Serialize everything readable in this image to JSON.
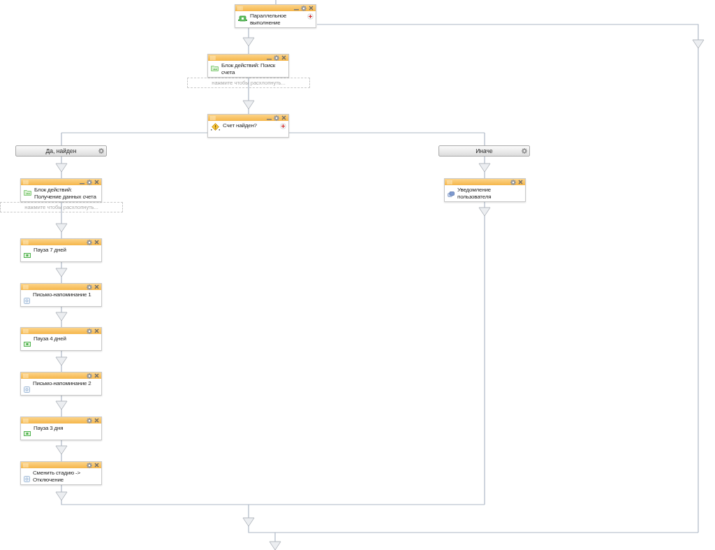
{
  "nodes": [
    {
      "kind": "parallel",
      "title": "Параллельное выполнение",
      "minimizable": true,
      "addable": true
    },
    {
      "kind": "block",
      "title": "Блок действий: Поиск счета",
      "minimizable": true,
      "addable": false,
      "hint": "нажмите чтобы расхлопнуть..."
    },
    {
      "kind": "condition",
      "title": "Счет найден?",
      "minimizable": true,
      "addable": true
    },
    {
      "kind": "block",
      "title": "Блок действий: Получение данных счета",
      "minimizable": true,
      "addable": false,
      "hint": "нажмите чтобы расхлопнуть..."
    },
    {
      "kind": "notify",
      "title": "Уведомление пользователя",
      "minimizable": false,
      "addable": false
    },
    {
      "kind": "delay",
      "title": "Пауза 7 дней",
      "minimizable": false,
      "addable": false
    },
    {
      "kind": "activity",
      "title": "Письмо-напоминание 1",
      "minimizable": false,
      "addable": false
    },
    {
      "kind": "delay",
      "title": "Пауза 4 дней",
      "minimizable": false,
      "addable": false
    },
    {
      "kind": "activity",
      "title": "Письмо-напоминание 2",
      "minimizable": false,
      "addable": false
    },
    {
      "kind": "delay",
      "title": "Пауза 3 дня",
      "minimizable": false,
      "addable": false
    },
    {
      "kind": "activity",
      "title": "Сменить стадию -> Отключение",
      "minimizable": false,
      "addable": false
    }
  ],
  "branches": [
    {
      "label": "Да, найден"
    },
    {
      "label": "Иначе"
    }
  ]
}
